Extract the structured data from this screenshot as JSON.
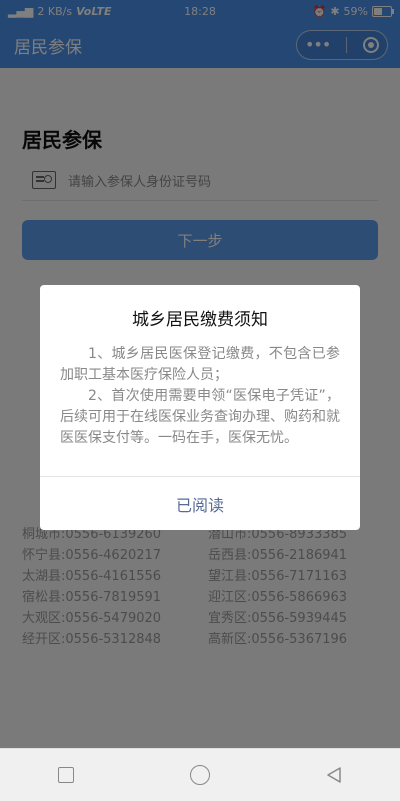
{
  "status_bar": {
    "left_text": "2 KB/s",
    "volte": "VoLTE",
    "time": "18:28",
    "battery": "59%",
    "battery_level": 0.59
  },
  "app_bar": {
    "title": "居民参保",
    "menu_icon": "more-dots-icon",
    "close_icon": "target-circle-icon"
  },
  "form": {
    "section_title": "居民参保",
    "id_placeholder": "请输入参保人身份证号码",
    "next_button": "下一步"
  },
  "phones": [
    {
      "label": "桐城市:0556-6139260"
    },
    {
      "label": "潜山市:0556-8933385"
    },
    {
      "label": "怀宁县:0556-4620217"
    },
    {
      "label": "岳西县:0556-2186941"
    },
    {
      "label": "太湖县:0556-4161556"
    },
    {
      "label": "望江县:0556-7171163"
    },
    {
      "label": "宿松县:0556-7819591"
    },
    {
      "label": "迎江区:0556-5866963"
    },
    {
      "label": "大观区:0556-5479020"
    },
    {
      "label": "宜秀区:0556-5939445"
    },
    {
      "label": "经开区:0556-5312848"
    },
    {
      "label": "高新区:0556-5367196"
    }
  ],
  "dialog": {
    "title": "城乡居民缴费须知",
    "para1": "1、城乡居民医保登记缴费，不包含已参加职工基本医疗保险人员；",
    "para2": "2、首次使用需要申领“医保电子凭证”，后续可用于在线医保业务查询办理、购药和就医医保支付等。一码在手，医保无忧。",
    "confirm": "已阅读"
  },
  "nav": {
    "recent_icon": "square-icon",
    "home_icon": "circle-icon",
    "back_icon": "triangle-back-icon"
  },
  "colors": {
    "primary": "#4a8fe6",
    "dialog_link": "#576b95"
  }
}
